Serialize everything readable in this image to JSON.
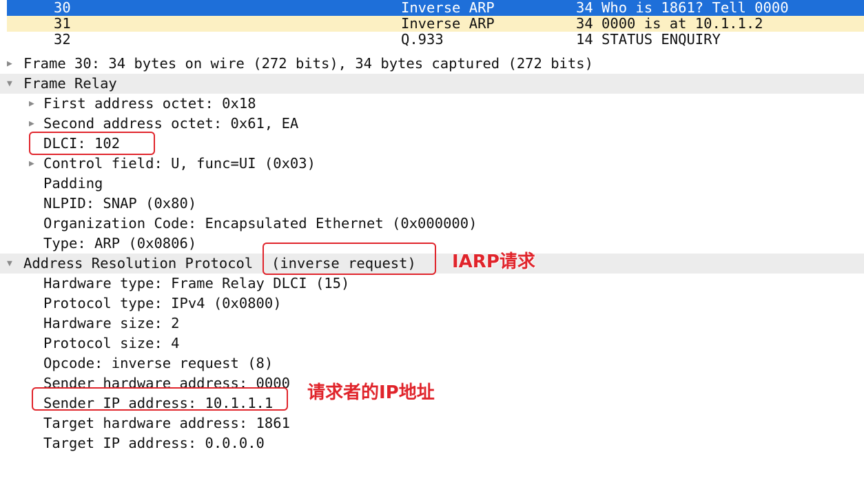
{
  "packet_list": [
    {
      "no": "30",
      "protocol": "Inverse ARP",
      "info": "34 Who is 1861? Tell 0000",
      "state": "selected"
    },
    {
      "no": "31",
      "protocol": "Inverse ARP",
      "info": "34 0000 is at 10.1.1.2",
      "state": "normal"
    },
    {
      "no": "32",
      "protocol": "Q.933",
      "info": "14 STATUS ENQUIRY",
      "state": "partial"
    }
  ],
  "tree": {
    "frame": "Frame 30: 34 bytes on wire (272 bits), 34 bytes captured (272 bits)",
    "frame_relay": {
      "label": "Frame Relay",
      "first_addr": "First address octet: 0x18",
      "second_addr": "Second address octet: 0x61, EA",
      "dlci": "DLCI: 102",
      "control": "Control field: U, func=UI (0x03)",
      "padding": "Padding",
      "nlpid": "NLPID: SNAP (0x80)",
      "org_code": "Organization Code: Encapsulated Ethernet (0x000000)",
      "type": "Type: ARP (0x0806)"
    },
    "arp": {
      "label_prefix": "Address Resolution Protocol",
      "label_suffix": "(inverse request)",
      "hw_type": "Hardware type: Frame Relay DLCI (15)",
      "proto_type": "Protocol type: IPv4 (0x0800)",
      "hw_size": "Hardware size: 2",
      "proto_size": "Protocol size: 4",
      "opcode": "Opcode: inverse request (8)",
      "sender_hw": "Sender hardware address: 0000",
      "sender_ip": "Sender IP address: 10.1.1.1",
      "target_hw": "Target hardware address: 1861",
      "target_ip": "Target IP address: 0.0.0.0"
    }
  },
  "annotations": {
    "iarp_request": "IARP请求",
    "requester_ip": "请求者的IP地址"
  },
  "colors": {
    "selected_row": "#1e6fd9",
    "normal_row": "#fcf0c3",
    "header_row": "#ececec",
    "annotation": "#e0242b"
  }
}
